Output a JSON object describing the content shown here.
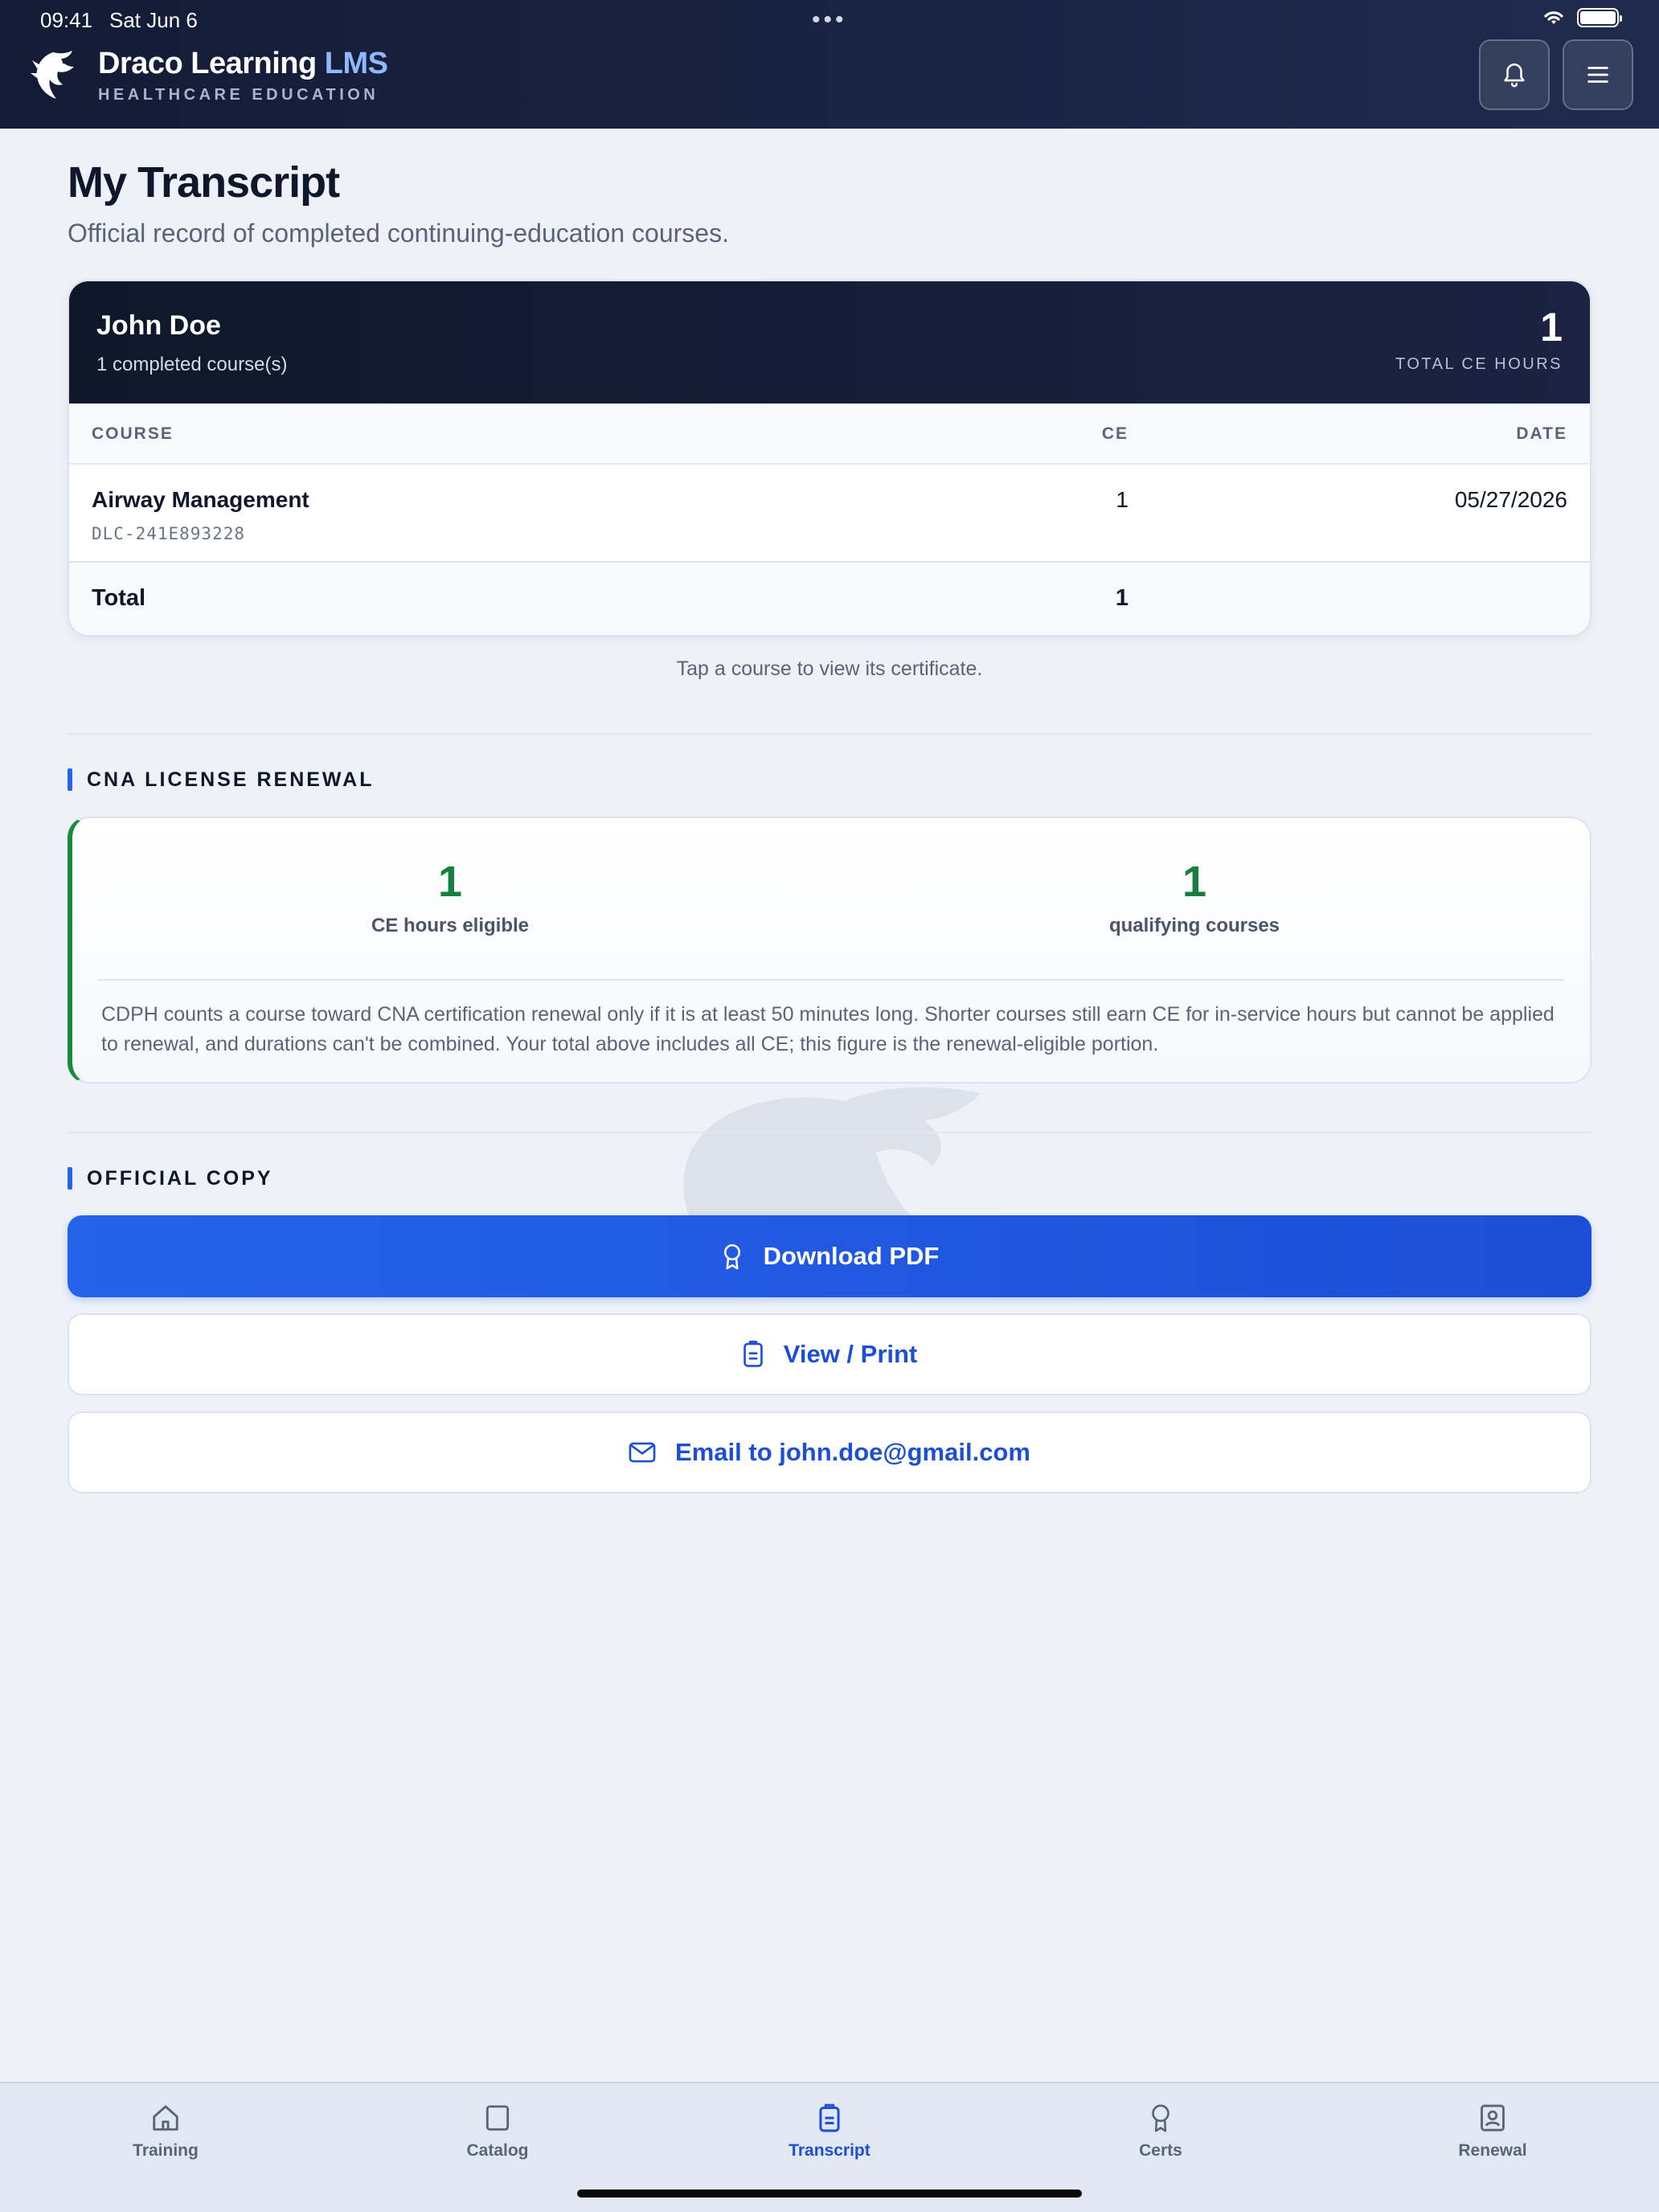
{
  "status_bar": {
    "time": "09:41",
    "date": "Sat Jun 6",
    "dots": "•••"
  },
  "header": {
    "brand_name": "Draco Learning",
    "brand_accent": "LMS",
    "brand_tagline": "HEALTHCARE EDUCATION",
    "icons": [
      "dragon-logo",
      "bell-icon",
      "menu-icon"
    ]
  },
  "page": {
    "title": "My Transcript",
    "subtitle": "Official record of completed continuing-education courses."
  },
  "transcript": {
    "student_name": "John Doe",
    "completed_summary": "1 completed course(s)",
    "total_ce": "1",
    "total_ce_label": "TOTAL CE HOURS",
    "columns": {
      "course": "COURSE",
      "ce": "CE",
      "date": "DATE"
    },
    "rows": [
      {
        "course": "Airway Management",
        "id": "DLC-241E893228",
        "ce": "1",
        "date": "05/27/2026"
      }
    ],
    "total_label": "Total",
    "total_value": "1",
    "hint": "Tap a course to view its certificate."
  },
  "renewal": {
    "section_title": "CNA LICENSE RENEWAL",
    "eligible_hours": "1",
    "eligible_hours_label": "CE hours eligible",
    "qualifying_courses": "1",
    "qualifying_courses_label": "qualifying courses",
    "note": "CDPH counts a course toward CNA certification renewal only if it is at least 50 minutes long. Shorter courses still earn CE for in-service hours but cannot be applied to renewal, and durations can't be combined. Your total above includes all CE; this figure is the renewal-eligible portion."
  },
  "official_copy": {
    "section_title": "OFFICIAL COPY",
    "download_label": "Download PDF",
    "view_label": "View / Print",
    "email_label": "Email to john.doe@gmail.com"
  },
  "tabs": [
    {
      "label": "Training",
      "icon": "home-icon"
    },
    {
      "label": "Catalog",
      "icon": "catalog-icon"
    },
    {
      "label": "Transcript",
      "icon": "transcript-icon",
      "active": true
    },
    {
      "label": "Certs",
      "icon": "award-icon"
    },
    {
      "label": "Renewal",
      "icon": "renewal-icon"
    }
  ],
  "colors": {
    "header_bg": "#131c35",
    "accent_blue": "#2563eb",
    "success_green": "#15803d",
    "brand_accent": "#8fb8ff"
  }
}
